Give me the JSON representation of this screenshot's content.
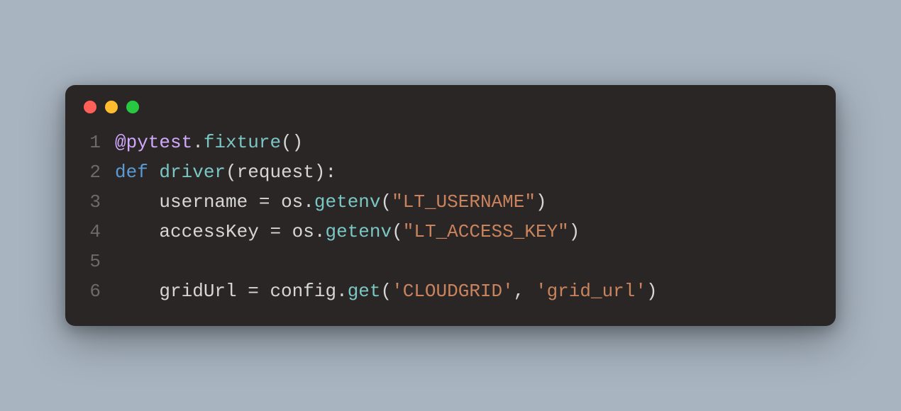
{
  "window": {
    "dots": [
      "red",
      "yellow",
      "green"
    ]
  },
  "code": {
    "lines": [
      {
        "num": "1",
        "tokens": [
          {
            "cls": "tok-at",
            "t": "@pytest"
          },
          {
            "cls": "tok-dec",
            "t": "."
          },
          {
            "cls": "tok-fn",
            "t": "fixture"
          },
          {
            "cls": "tok-dec",
            "t": "()"
          }
        ]
      },
      {
        "num": "2",
        "tokens": [
          {
            "cls": "tok-kw",
            "t": "def "
          },
          {
            "cls": "tok-fn",
            "t": "driver"
          },
          {
            "cls": "tok-dec",
            "t": "("
          },
          {
            "cls": "tok-name",
            "t": "request"
          },
          {
            "cls": "tok-dec",
            "t": "):"
          }
        ]
      },
      {
        "num": "3",
        "tokens": [
          {
            "cls": "tok-dec",
            "t": "    "
          },
          {
            "cls": "tok-var",
            "t": "username"
          },
          {
            "cls": "tok-dec",
            "t": " = "
          },
          {
            "cls": "tok-name",
            "t": "os"
          },
          {
            "cls": "tok-dec",
            "t": "."
          },
          {
            "cls": "tok-fn",
            "t": "getenv"
          },
          {
            "cls": "tok-dec",
            "t": "("
          },
          {
            "cls": "tok-str",
            "t": "\"LT_USERNAME\""
          },
          {
            "cls": "tok-dec",
            "t": ")"
          }
        ]
      },
      {
        "num": "4",
        "tokens": [
          {
            "cls": "tok-dec",
            "t": "    "
          },
          {
            "cls": "tok-var",
            "t": "accessKey"
          },
          {
            "cls": "tok-dec",
            "t": " = "
          },
          {
            "cls": "tok-name",
            "t": "os"
          },
          {
            "cls": "tok-dec",
            "t": "."
          },
          {
            "cls": "tok-fn",
            "t": "getenv"
          },
          {
            "cls": "tok-dec",
            "t": "("
          },
          {
            "cls": "tok-str",
            "t": "\"LT_ACCESS_KEY\""
          },
          {
            "cls": "tok-dec",
            "t": ")"
          }
        ]
      },
      {
        "num": "5",
        "tokens": []
      },
      {
        "num": "6",
        "tokens": [
          {
            "cls": "tok-dec",
            "t": "    "
          },
          {
            "cls": "tok-var",
            "t": "gridUrl"
          },
          {
            "cls": "tok-dec",
            "t": " = "
          },
          {
            "cls": "tok-name",
            "t": "config"
          },
          {
            "cls": "tok-dec",
            "t": "."
          },
          {
            "cls": "tok-fn",
            "t": "get"
          },
          {
            "cls": "tok-dec",
            "t": "("
          },
          {
            "cls": "tok-str",
            "t": "'CLOUDGRID'"
          },
          {
            "cls": "tok-dec",
            "t": ", "
          },
          {
            "cls": "tok-str",
            "t": "'grid_url'"
          },
          {
            "cls": "tok-dec",
            "t": ")"
          }
        ]
      }
    ]
  }
}
